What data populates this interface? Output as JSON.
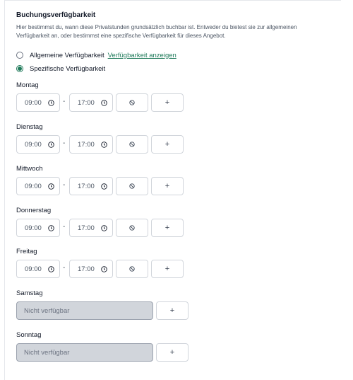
{
  "section": {
    "title": "Buchungsverfügbarkeit",
    "description": "Hier bestimmst du, wann diese Privatstunden grundsätzlich buchbar ist. Entweder du bietest sie zur allgemeinen Verfügbarkeit an, oder bestimmst eine spezifische Verfügbarkeit für dieses Angebot."
  },
  "options": {
    "general": {
      "label": "Allgemeine Verfügbarkeit",
      "link": "Verfügbarkeit anzeigen",
      "selected": false
    },
    "specific": {
      "label": "Spezifische Verfügbarkeit",
      "selected": true
    }
  },
  "days": [
    {
      "label": "Montag",
      "start": "09:00",
      "end": "17:00",
      "available": true
    },
    {
      "label": "Dienstag",
      "start": "09:00",
      "end": "17:00",
      "available": true
    },
    {
      "label": "Mittwoch",
      "start": "09:00",
      "end": "17:00",
      "available": true
    },
    {
      "label": "Donnerstag",
      "start": "09:00",
      "end": "17:00",
      "available": true
    },
    {
      "label": "Freitag",
      "start": "09:00",
      "end": "17:00",
      "available": true
    },
    {
      "label": "Samstag",
      "unavailable_text": "Nicht verfügbar",
      "available": false
    },
    {
      "label": "Sonntag",
      "unavailable_text": "Nicht verfügbar",
      "available": false
    }
  ],
  "symbols": {
    "separator": "-",
    "add": "+"
  },
  "icons": {
    "clock": "clock-icon",
    "disable": "ban-icon",
    "add": "plus-icon"
  },
  "colors": {
    "accent": "#1f7a5a",
    "unavailable_bg": "#d1d5db"
  }
}
